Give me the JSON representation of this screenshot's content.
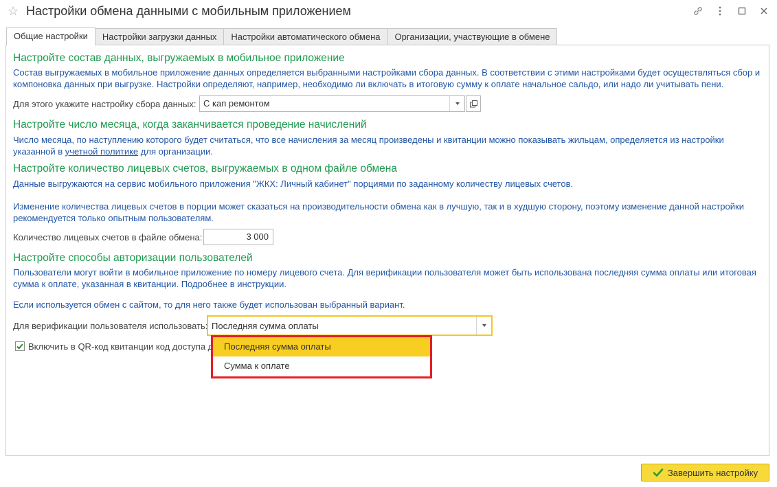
{
  "window": {
    "title": "Настройки обмена данными с мобильным приложением"
  },
  "tabs": [
    {
      "label": "Общие настройки",
      "active": true
    },
    {
      "label": "Настройки загрузки данных",
      "active": false
    },
    {
      "label": "Настройки автоматического обмена",
      "active": false
    },
    {
      "label": "Организации, участвующие в обмене",
      "active": false
    }
  ],
  "section1": {
    "heading": "Настройте состав данных, выгружаемых в мобильное приложение",
    "line1": "Состав выгружаемых в мобильное приложение данных определяется выбранными настройками сбора данных. В соответствии с этими настройками будет осуществляться сбор и",
    "line2": "компоновка данных при выгрузке. Настройки определяют, например, необходимо ли включать в итоговую сумму к оплате начальное сальдо, или надо ли учитывать пени.",
    "field_label": "Для этого укажите настройку сбора данных:",
    "field_value": "С кап ремонтом"
  },
  "section2": {
    "heading": "Настройте число месяца, когда заканчивается проведение начислений",
    "line1": "Число месяца, по наступлению которого будет считаться, что все начисления за месяц произведены и квитанции можно показывать жильцам, определяется из настройки",
    "line2_pre": "указанной в ",
    "line2_link": "учетной политике",
    "line2_post": " для организации."
  },
  "section3": {
    "heading": "Настройте количество лицевых счетов, выгружаемых в одном файле обмена",
    "line1": "Данные выгружаются на сервис мобильного приложения \"ЖКХ: Личный кабинет\" порциями по заданному количеству лицевых счетов.",
    "line2": "Изменение количества лицевых счетов в порции может сказаться на производительности обмена как в лучшую, так и в худшую сторону, поэтому изменение данной настройки",
    "line3": "рекомендуется только опытным пользователям.",
    "field_label": "Количество лицевых счетов в файле обмена:",
    "field_value": "3 000"
  },
  "section4": {
    "heading": "Настройте способы авторизации пользователей",
    "line1": "Пользователи могут войти в мобильное приложение по номеру лицевого счета. Для верификации пользователя может быть использована последняя сумма оплаты или итоговая",
    "line2": "сумма к оплате, указанная в квитанции. Подробнее в инструкции.",
    "line3": "Если используется обмен с сайтом, то для него также будет использован выбранный вариант.",
    "field_label": "Для верификации пользователя использовать:",
    "field_value": "Последняя сумма оплаты",
    "options": [
      "Последняя сумма оплаты",
      "Сумма к оплате"
    ],
    "checkbox_label": "Включить в QR-код квитанции код доступа д",
    "checkbox_checked": true
  },
  "footer": {
    "finish_label": "Завершить настройку"
  },
  "colors": {
    "heading_green": "#1f9a4f",
    "text_blue": "#2156a5",
    "highlight_yellow": "#f9ce22",
    "callout_red": "#e31e24",
    "button_yellow": "#f7d93a"
  }
}
